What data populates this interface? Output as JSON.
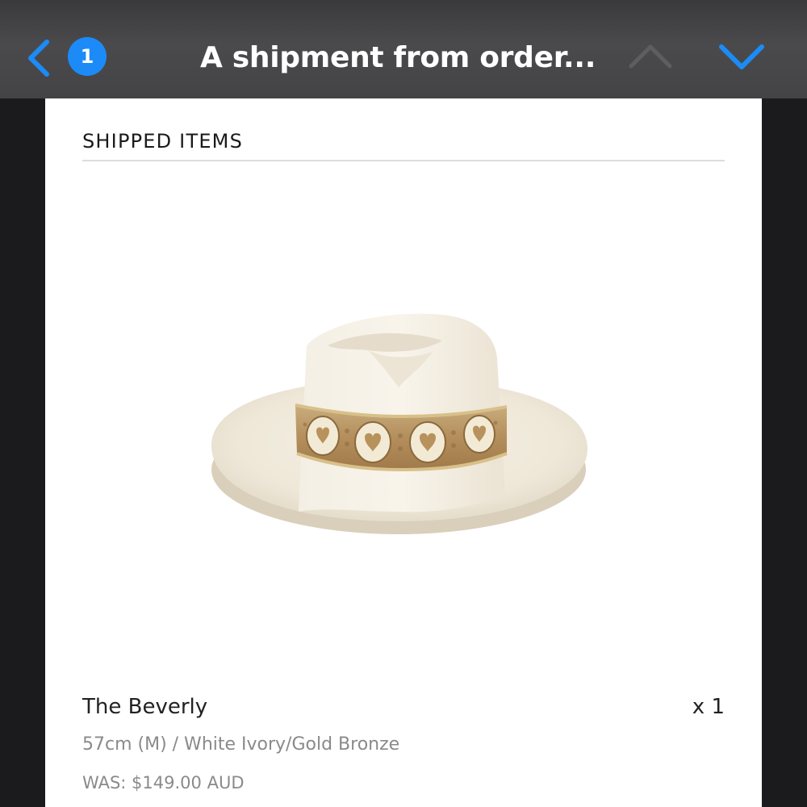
{
  "navbar": {
    "back_icon": "chevron-left-icon",
    "unread_count": "1",
    "title": "A shipment from order...",
    "prev_icon": "chevron-up-icon",
    "next_icon": "chevron-down-icon",
    "accent_color": "#1c8bf7"
  },
  "email": {
    "section_title": "SHIPPED ITEMS",
    "items": [
      {
        "image": "ivory-fedora-hat-with-gold-bronze-band",
        "name": "The Beverly",
        "quantity": "x 1",
        "variant": "57cm (M) / White Ivory/Gold Bronze",
        "was_price": "WAS: $149.00 AUD"
      }
    ]
  }
}
